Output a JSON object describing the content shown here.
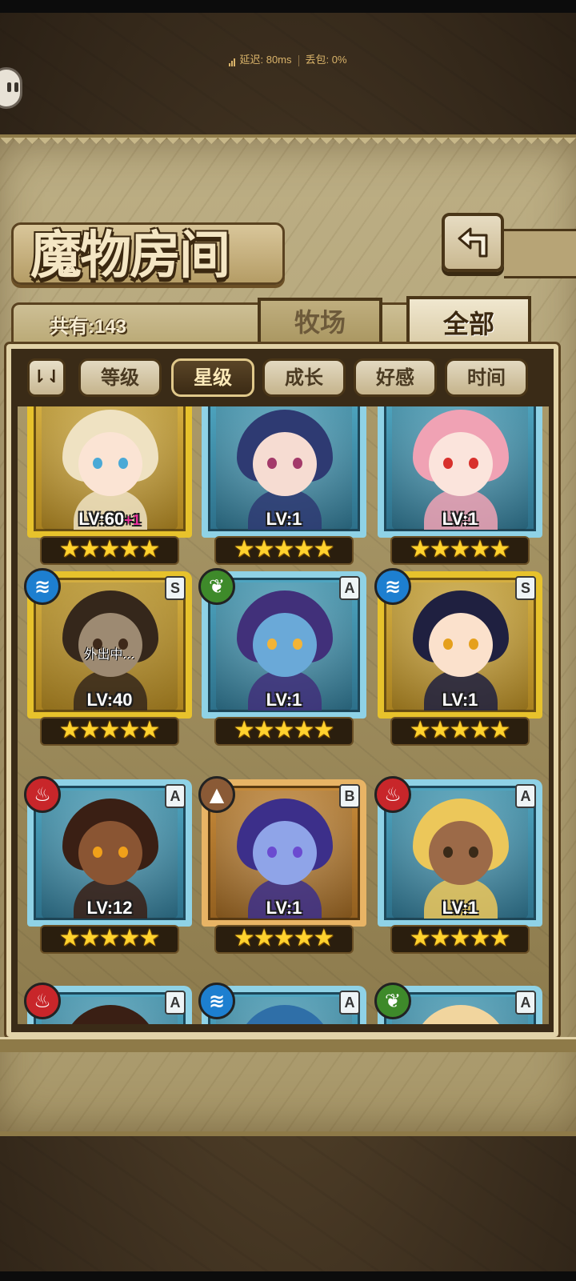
{
  "status": {
    "latency": "延迟: 80ms",
    "packet_loss": "丢包: 0%"
  },
  "title": "魔物房间",
  "count_label": "共有:143",
  "tabs": [
    {
      "label": "牧场",
      "selected": false
    },
    {
      "label": "全部",
      "selected": true
    }
  ],
  "sort": {
    "toggle_label": "⇂⇃",
    "options": [
      {
        "label": "等级",
        "active": false
      },
      {
        "label": "星级",
        "active": true
      },
      {
        "label": "成长",
        "active": false
      },
      {
        "label": "好感",
        "active": false
      },
      {
        "label": "时间",
        "active": false
      }
    ]
  },
  "colors": {
    "accent_gold": "#e7c22c",
    "accent_blue": "#8fd2e6",
    "accent_bronze": "#e8b465",
    "star": "#ffd22e",
    "active_tab": "#3b2a14"
  },
  "monsters": [
    {
      "level": "LV:60",
      "bonus": "+1",
      "stars": 5,
      "frame": "gold",
      "element": "",
      "rank": "",
      "status": "",
      "hair": "#efe2c2",
      "skin": "#fbe4d4",
      "eye": "#4aa9d6"
    },
    {
      "level": "LV:1",
      "bonus": "",
      "stars": 5,
      "frame": "blue",
      "element": "",
      "rank": "",
      "status": "",
      "hair": "#2e3a72",
      "skin": "#f6dcd2",
      "eye": "#a33a6a"
    },
    {
      "level": "LV:1",
      "bonus": "",
      "stars": 5,
      "frame": "blue",
      "element": "",
      "rank": "",
      "status": "",
      "hair": "#f0a2b4",
      "skin": "#fbe4dc",
      "eye": "#d8302c"
    },
    {
      "level": "LV:40",
      "bonus": "",
      "stars": 5,
      "frame": "gold",
      "element": "water",
      "rank": "S",
      "status": "外出中...",
      "hair": "#5a3a22",
      "skin": "#f1d3b6",
      "eye": "#6e3b1c"
    },
    {
      "level": "LV:1",
      "bonus": "",
      "stars": 5,
      "frame": "blue",
      "element": "grass",
      "rank": "A",
      "status": "",
      "hair": "#41307a",
      "skin": "#6aa9d8",
      "eye": "#f3b437"
    },
    {
      "level": "LV:1",
      "bonus": "",
      "stars": 5,
      "frame": "gold",
      "element": "water",
      "rank": "S",
      "status": "",
      "hair": "#1f2040",
      "skin": "#fbe1cc",
      "eye": "#e5a01c"
    },
    {
      "level": "LV:12",
      "bonus": "",
      "stars": 5,
      "frame": "blue",
      "element": "fire",
      "rank": "A",
      "status": "",
      "hair": "#3a1f14",
      "skin": "#8a5533",
      "eye": "#f0a01a"
    },
    {
      "level": "LV:1",
      "bonus": "",
      "stars": 5,
      "frame": "bronze",
      "element": "earth",
      "rank": "B",
      "status": "",
      "hair": "#3c2f8a",
      "skin": "#8fa4e8",
      "eye": "#6b4bd0"
    },
    {
      "level": "LV:1",
      "bonus": "",
      "stars": 5,
      "frame": "blue",
      "element": "fire",
      "rank": "A",
      "status": "",
      "hair": "#ecc75a",
      "skin": "#9c6a48",
      "eye": "#3a2a18"
    },
    {
      "level": "",
      "bonus": "",
      "stars": 0,
      "frame": "blue",
      "element": "fire",
      "rank": "A",
      "status": "",
      "hair": "#3a1f14",
      "skin": "#caa186",
      "eye": "#333333"
    },
    {
      "level": "",
      "bonus": "",
      "stars": 0,
      "frame": "blue",
      "element": "water",
      "rank": "A",
      "status": "",
      "hair": "#2f6fa8",
      "skin": "#bfd9ec",
      "eye": "#333333"
    },
    {
      "level": "",
      "bonus": "",
      "stars": 0,
      "frame": "blue",
      "element": "grass",
      "rank": "A",
      "status": "",
      "hair": "#f1d59e",
      "skin": "#f7e2cc",
      "eye": "#333333"
    }
  ]
}
